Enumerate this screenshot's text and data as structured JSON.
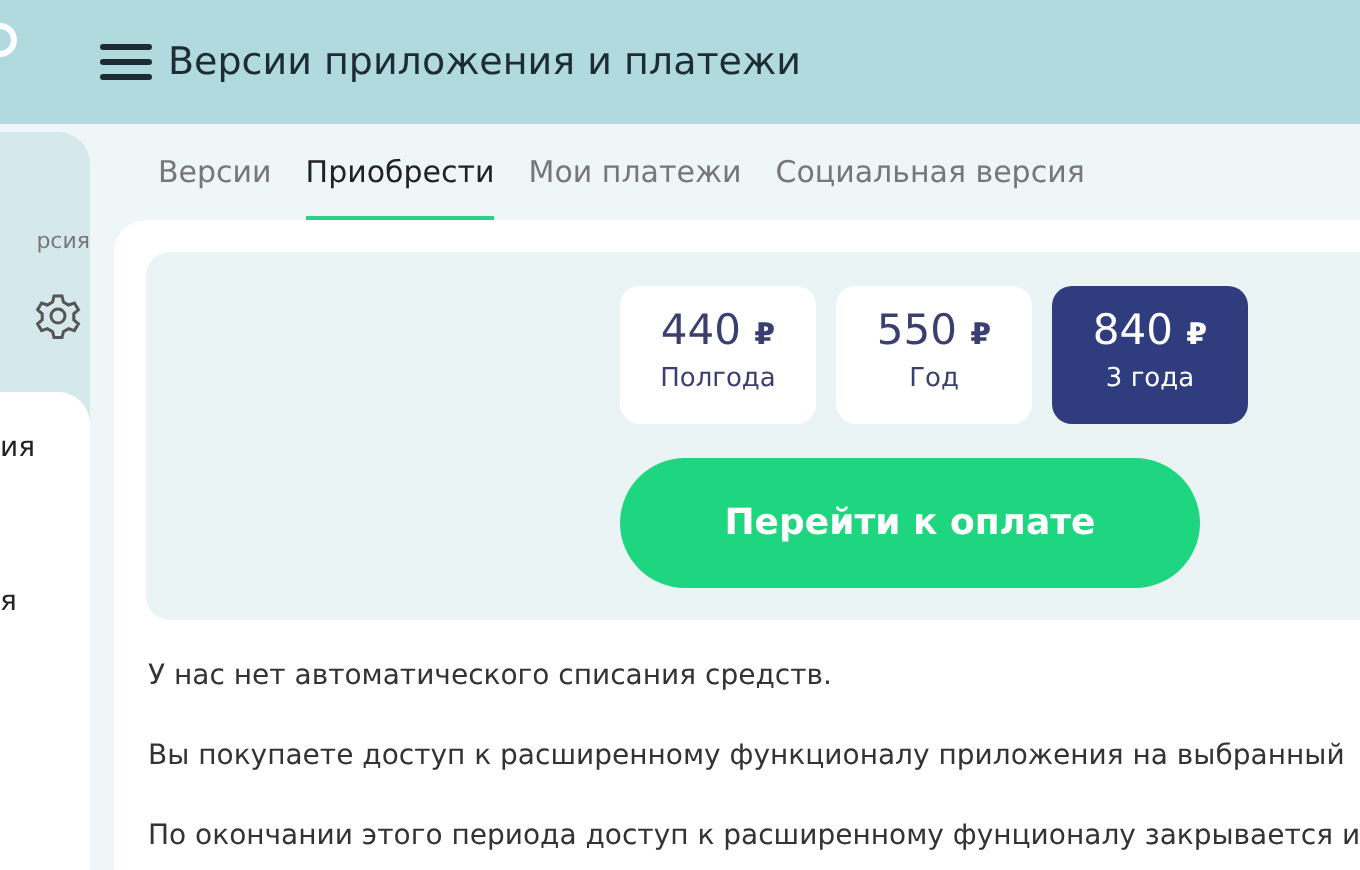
{
  "header": {
    "title": "Версии приложения и платежи"
  },
  "sidebar": {
    "caption": "рсия",
    "items": [
      "ия",
      "я"
    ]
  },
  "tabs": [
    {
      "label": "Версии",
      "selected": false
    },
    {
      "label": "Приобрести",
      "selected": true
    },
    {
      "label": "Мои платежи",
      "selected": false
    },
    {
      "label": "Социальная версия",
      "selected": false
    }
  ],
  "plans": [
    {
      "price": "440",
      "currency": "₽",
      "period": "Полгода",
      "selected": false
    },
    {
      "price": "550",
      "currency": "₽",
      "period": "Год",
      "selected": false
    },
    {
      "price": "840",
      "currency": "₽",
      "period": "3 года",
      "selected": true
    }
  ],
  "pay_button": "Перейти к оплате",
  "paragraphs": [
    "У нас нет автоматического списания средств.",
    "Вы покупаете доступ к расширенному функционалу приложения на выбранный",
    "По окончании этого периода доступ к расширенному фунционалу закрывается и"
  ]
}
